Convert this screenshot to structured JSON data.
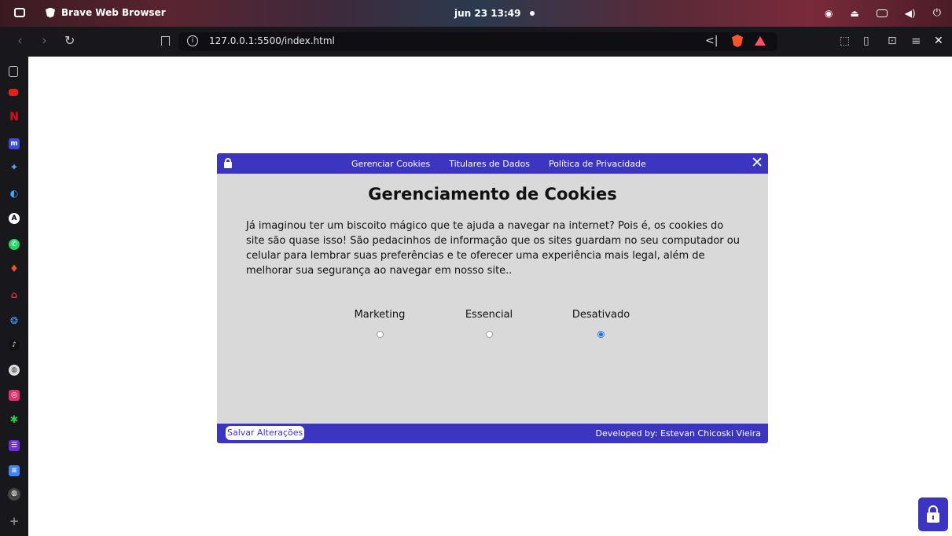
{
  "os": {
    "app_name": "Brave Web Browser",
    "clock": "jun 23  13:49"
  },
  "browser": {
    "url": "127.0.0.1:5500/index.html"
  },
  "modal": {
    "nav": [
      "Gerenciar Cookies",
      "Titulares de Dados",
      "Política de Privacidade"
    ],
    "close_label": "✕",
    "title": "Gerenciamento de Cookies",
    "description": "Já imaginou ter um biscoito mágico que te ajuda a navegar na internet? Pois é, os cookies do site são quase isso! São pedacinhos de informação que os sites guardam no seu computador ou celular para lembrar suas preferências e te oferecer uma experiência mais legal, além de melhorar sua segurança ao navegar em nosso site..",
    "options": [
      {
        "label": "Marketing",
        "checked": false
      },
      {
        "label": "Essencial",
        "checked": false
      },
      {
        "label": "Desativado",
        "checked": true
      }
    ],
    "save_label": "Salvar Alterações",
    "credit": "Developed by: Estevan Chicoski Vieira"
  },
  "colors": {
    "accent": "#3b35c2",
    "modal_bg": "#d9d9d9"
  }
}
